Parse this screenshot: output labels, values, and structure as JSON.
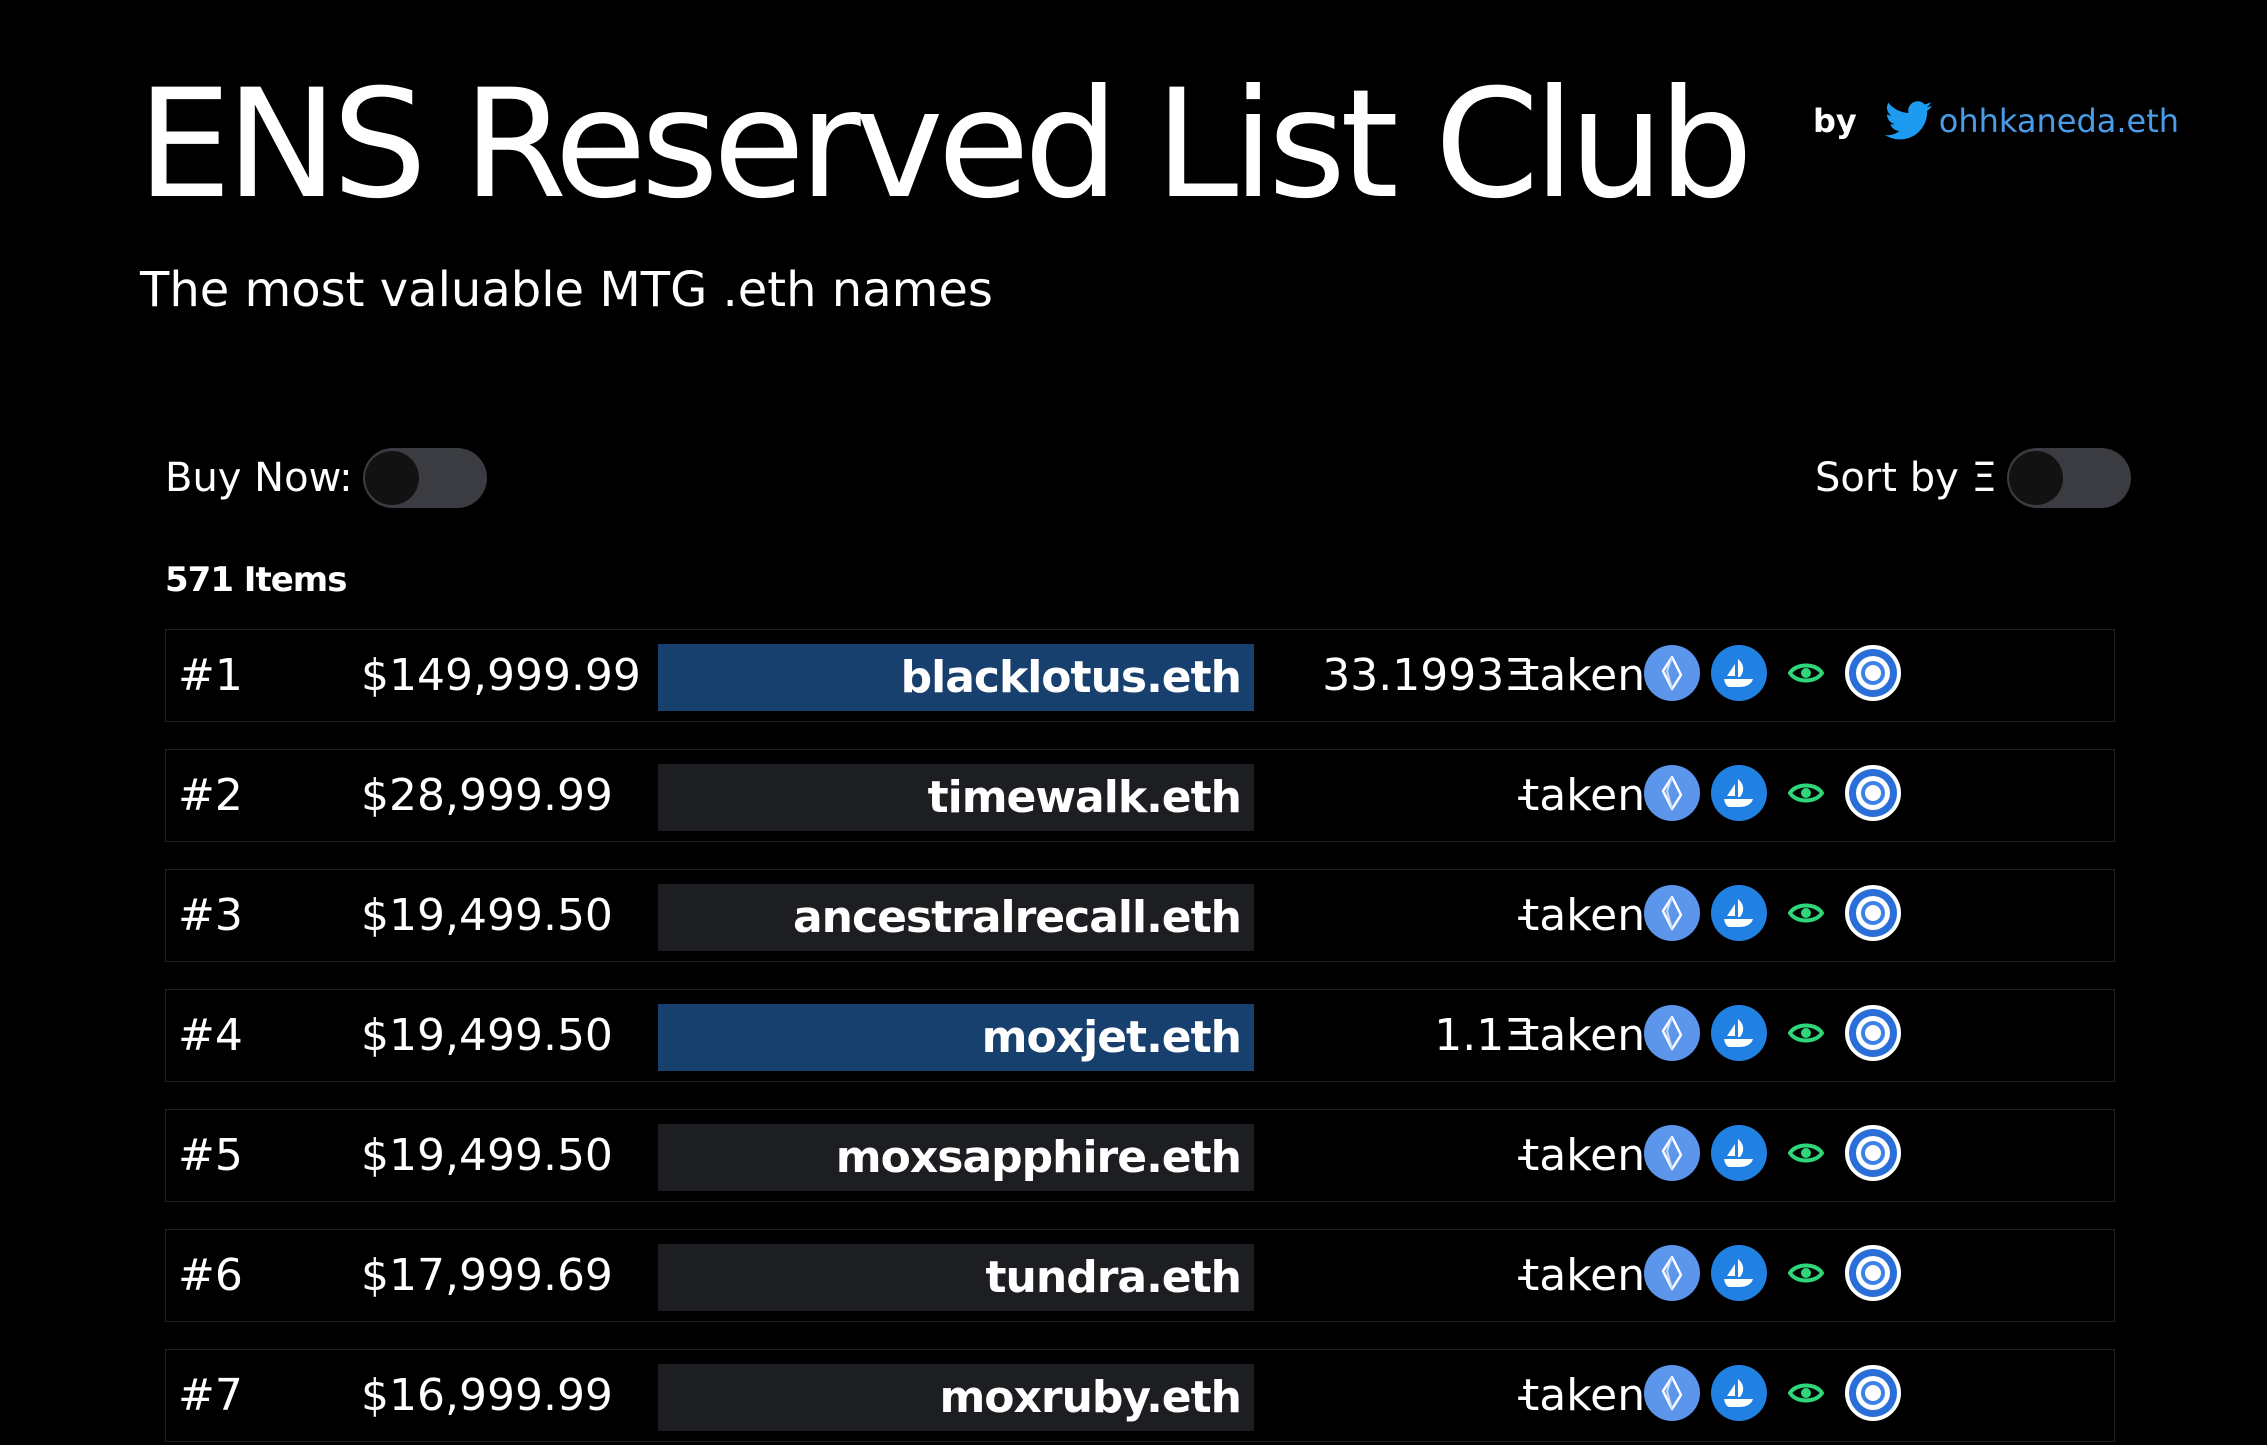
{
  "header": {
    "title": "ENS Reserved List Club",
    "subtitle": "The most valuable MTG .eth names",
    "by_label": "by",
    "author": "ohhkaneda.eth"
  },
  "controls": {
    "buy_now_label": "Buy Now:",
    "buy_now_on": false,
    "sort_label": "Sort by Ξ",
    "sort_on": false
  },
  "count_label": "571 Items",
  "colors": {
    "background": "#000000",
    "listed_name_bg": "#18406e",
    "unlisted_name_bg": "#1d1e21",
    "link": "#4a9ce8",
    "ens_icon": "#5b96ec",
    "opensea_icon": "#2081e2",
    "eye_icon": "#2fd77a"
  },
  "icons": [
    "ens-icon",
    "opensea-icon",
    "eye-icon",
    "rainbow-icon"
  ],
  "rows": [
    {
      "rank": "#1",
      "price": "$149,999.99",
      "name": "blacklotus.eth",
      "eth": "33.1993Ξ",
      "status": "taken",
      "listed": true
    },
    {
      "rank": "#2",
      "price": "$28,999.99",
      "name": "timewalk.eth",
      "eth": "-",
      "status": "taken",
      "listed": false
    },
    {
      "rank": "#3",
      "price": "$19,499.50",
      "name": "ancestralrecall.eth",
      "eth": "-",
      "status": "taken",
      "listed": false
    },
    {
      "rank": "#4",
      "price": "$19,499.50",
      "name": "moxjet.eth",
      "eth": "1.1Ξ",
      "status": "taken",
      "listed": true
    },
    {
      "rank": "#5",
      "price": "$19,499.50",
      "name": "moxsapphire.eth",
      "eth": "-",
      "status": "taken",
      "listed": false
    },
    {
      "rank": "#6",
      "price": "$17,999.69",
      "name": "tundra.eth",
      "eth": "-",
      "status": "taken",
      "listed": false
    },
    {
      "rank": "#7",
      "price": "$16,999.99",
      "name": "moxruby.eth",
      "eth": "-",
      "status": "taken",
      "listed": false
    }
  ]
}
